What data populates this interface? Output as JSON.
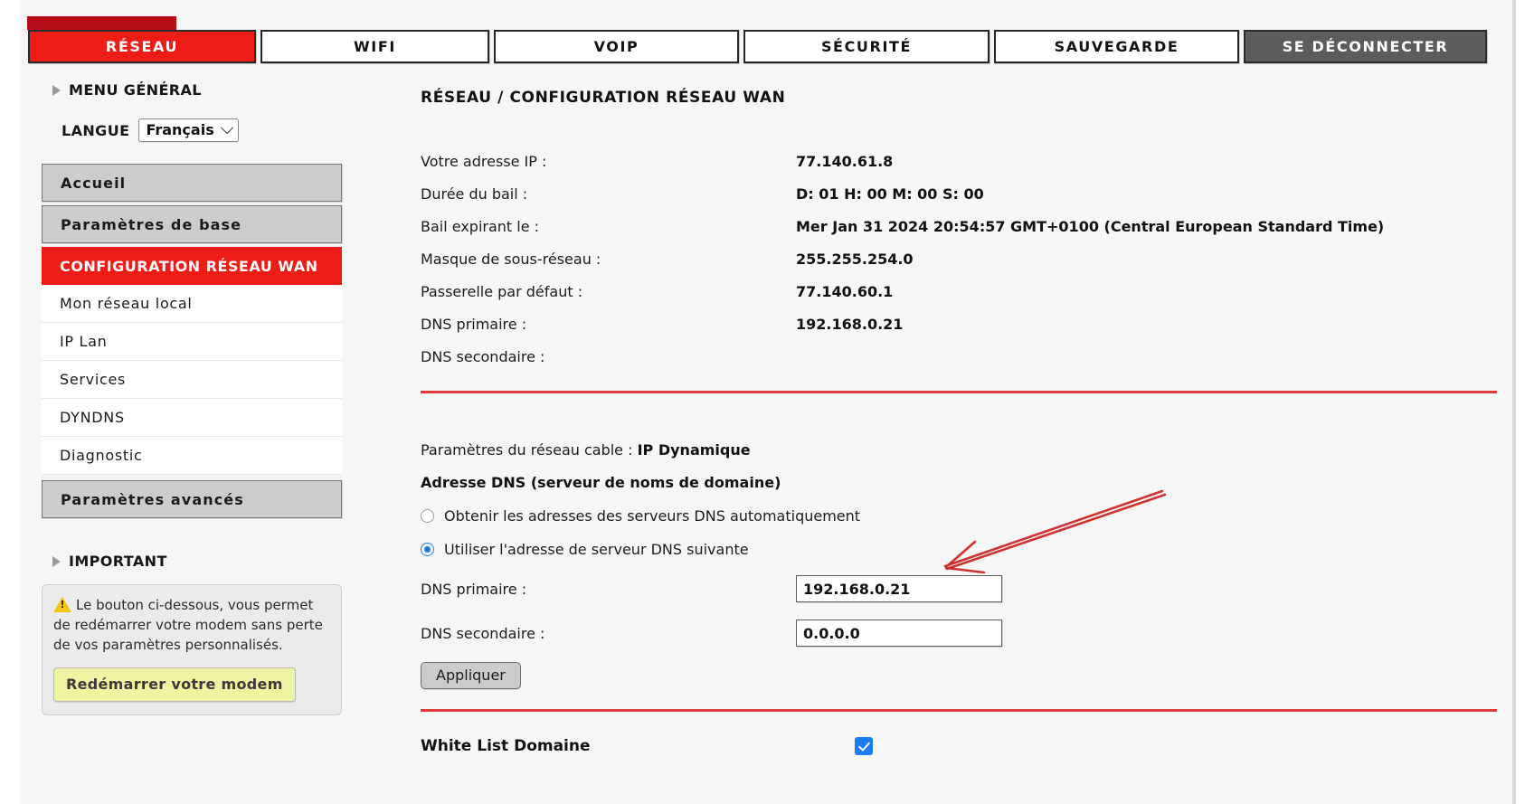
{
  "tabs": [
    {
      "label": "RÉSEAU",
      "state": "active",
      "name": "tab-reseau"
    },
    {
      "label": "WIFI",
      "state": "normal",
      "name": "tab-wifi"
    },
    {
      "label": "VOIP",
      "state": "normal",
      "name": "tab-voip"
    },
    {
      "label": "SÉCURITÉ",
      "state": "normal",
      "name": "tab-securite"
    },
    {
      "label": "SAUVEGARDE",
      "state": "normal",
      "name": "tab-sauvegarde"
    },
    {
      "label": "SE DÉCONNECTER",
      "state": "logout",
      "name": "tab-se-deconnecter"
    }
  ],
  "sidebar": {
    "menu_heading": "MENU GÉNÉRAL",
    "language_label": "LANGUE",
    "language_value": "Français",
    "items": [
      {
        "label": "Accueil",
        "type": "group"
      },
      {
        "label": "Paramètres de base",
        "type": "group"
      },
      {
        "label": "CONFIGURATION RÉSEAU WAN",
        "type": "active"
      },
      {
        "label": "Mon réseau local",
        "type": "plain"
      },
      {
        "label": "IP Lan",
        "type": "plain"
      },
      {
        "label": "Services",
        "type": "plain"
      },
      {
        "label": "DYNDNS",
        "type": "plain"
      },
      {
        "label": "Diagnostic",
        "type": "plain"
      },
      {
        "label": "Paramètres avancés",
        "type": "group"
      }
    ],
    "important_heading": "IMPORTANT",
    "notice_text": "Le bouton ci-dessous, vous permet de redémarrer votre modem sans perte de vos paramètres personnalisés.",
    "reboot_button": "Redémarrer votre modem"
  },
  "main": {
    "title": "RÉSEAU / CONFIGURATION RÉSEAU WAN",
    "info_rows": [
      {
        "label": "Votre adresse IP :",
        "value": "77.140.61.8"
      },
      {
        "label": "Durée du bail :",
        "value": "D: 01 H: 00 M: 00 S: 00"
      },
      {
        "label": "Bail expirant le :",
        "value": "Mer Jan 31 2024 20:54:57 GMT+0100 (Central European Standard Time)"
      },
      {
        "label": "Masque de sous-réseau :",
        "value": "255.255.254.0"
      },
      {
        "label": "Passerelle par défaut :",
        "value": "77.140.60.1"
      },
      {
        "label": "DNS primaire :",
        "value": "192.168.0.21"
      },
      {
        "label": "DNS secondaire :",
        "value": ""
      }
    ],
    "cable_label": "Paramètres du réseau cable :",
    "cable_value": "IP Dynamique",
    "dns_heading": "Adresse DNS (serveur de noms de domaine)",
    "radio_auto_label": "Obtenir les adresses des serveurs DNS automatiquement",
    "radio_auto_checked": false,
    "radio_manual_label": "Utiliser l'adresse de serveur DNS suivante",
    "radio_manual_checked": true,
    "dns_primary_label": "DNS primaire :",
    "dns_primary_value": "192.168.0.21",
    "dns_secondary_label": "DNS secondaire :",
    "dns_secondary_value": "0.0.0.0",
    "apply_button": "Appliquer",
    "whitelist_label": "White List Domaine",
    "whitelist_checked": true
  },
  "colors": {
    "brand_red": "#ed1c17",
    "dark_red": "#b50d17",
    "divider_red": "#e23b3b",
    "logout_gray": "#5c5c5c",
    "accent_blue": "#1a7cf5",
    "annotation_red": "#cf3232",
    "warning_yellow": "#f5c518",
    "reboot_yellow": "#edf5a3"
  }
}
